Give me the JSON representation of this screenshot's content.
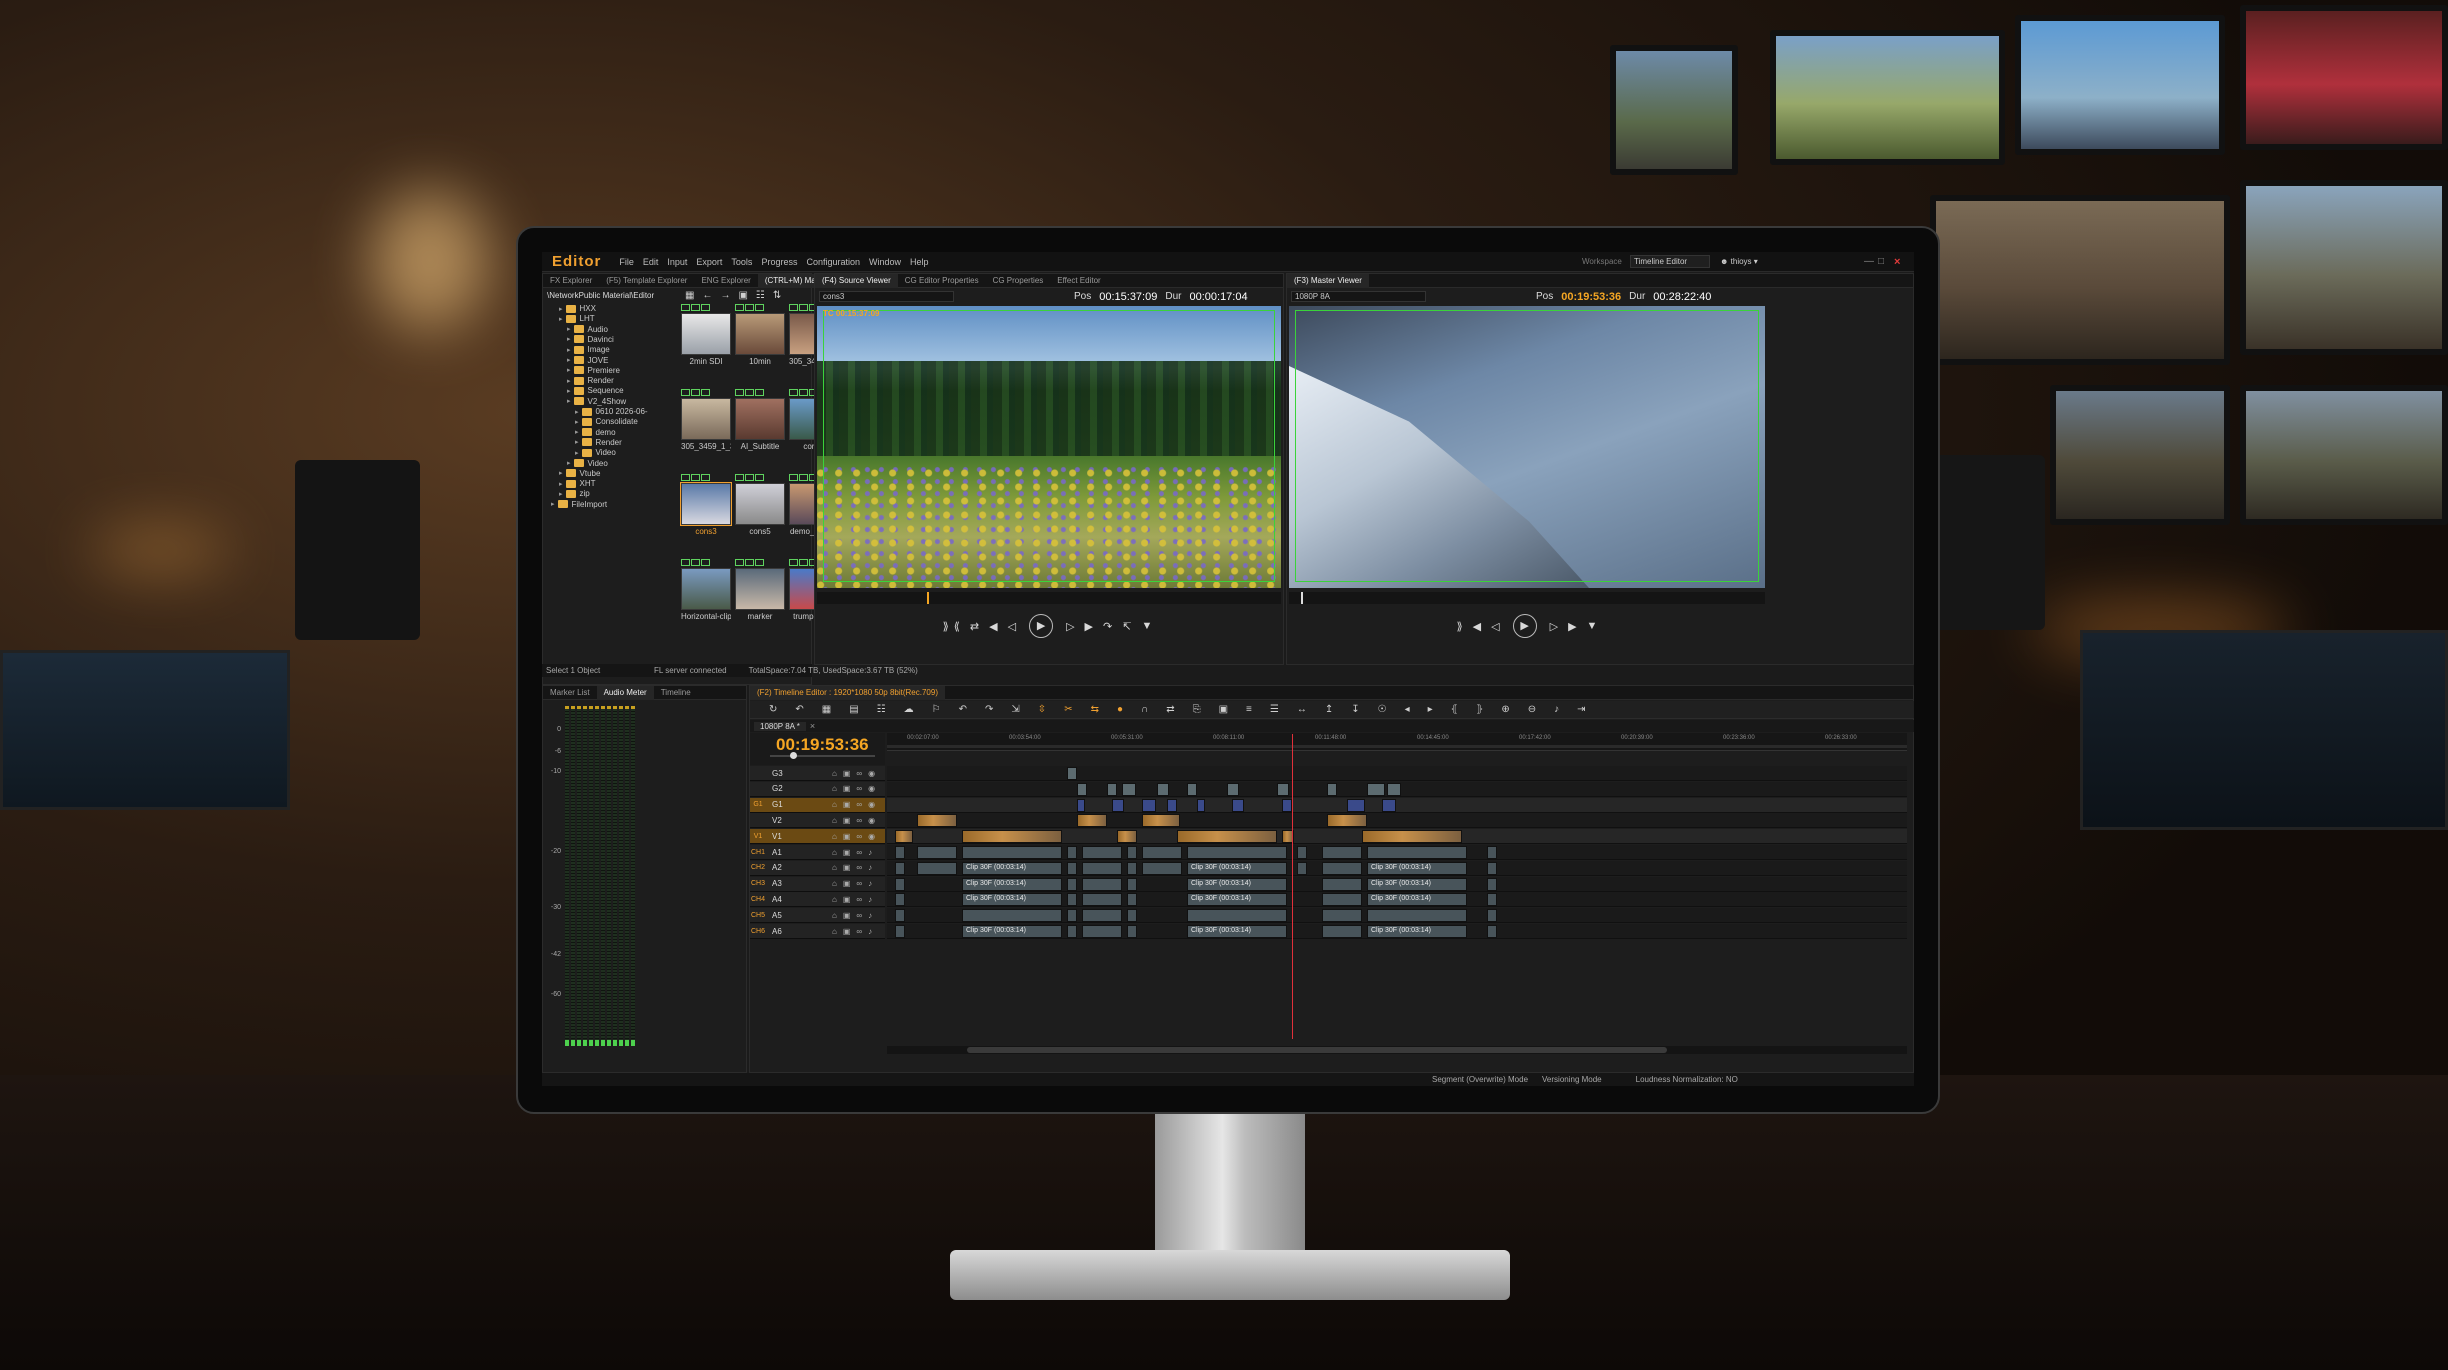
{
  "app": {
    "logo": "Editor"
  },
  "menu": [
    "File",
    "Edit",
    "Input",
    "Export",
    "Tools",
    "Progress",
    "Configuration",
    "Window",
    "Help"
  ],
  "workspace": {
    "label": "Workspace",
    "value": "Timeline Editor",
    "user": "thioys"
  },
  "explorer": {
    "tabs": [
      "FX Explorer",
      "(F5) Template Explorer",
      "ENG Explorer",
      "(CTRL+M) Material List"
    ],
    "path": "\\NetworkPublic Material\\Editor",
    "tree": [
      "HXX",
      "LHT",
      "Audio",
      "Davinci",
      "Image",
      "JOVE",
      "Premiere",
      "Render",
      "Sequence",
      "V2_4Show",
      "0610 2026-06-",
      "Consolidate",
      "demo",
      "Render",
      "Video",
      "Video",
      "Vtube",
      "XHT",
      "zip",
      "FileImport"
    ],
    "clips": [
      "2min SDI",
      "10min",
      "305_3455_1_43...",
      "305_3459_1_32...",
      "AI_Subtitle",
      "cons2",
      "cons3",
      "cons5",
      "demo_video1",
      "Horizontal-clip_c...",
      "marker",
      "trump video"
    ],
    "status_left": "Select 1 Object",
    "status_mid": "FL server connected",
    "status_right": "TotalSpace:7.04 TB, UsedSpace:3.67 TB (52%)"
  },
  "source_viewer": {
    "tabs": [
      "(F4) Source Viewer",
      "CG Editor Properties",
      "CG Properties",
      "Effect Editor"
    ],
    "clip": "cons3",
    "pos_label": "Pos",
    "pos": "00:15:37:09",
    "dur_label": "Dur",
    "dur": "00:00:17:04",
    "overlay_tc": "TC 00:15:37:09"
  },
  "master_viewer": {
    "tabs": [
      "(F3) Master Viewer"
    ],
    "format": "1080P 8A",
    "pos_label": "Pos",
    "pos": "00:19:53:36",
    "dur_label": "Dur",
    "dur": "00:28:22:40"
  },
  "bottom_left": {
    "tabs": [
      "Marker List",
      "Audio Meter",
      "Timeline"
    ],
    "scale": [
      "0",
      "-6",
      "-10",
      "-20",
      "-30",
      "-42",
      "-60"
    ]
  },
  "timeline": {
    "tab": "(F2) Timeline Editor : 1920*1080 50p 8bit(Rec.709)",
    "sequence": "1080P 8A *",
    "timecode": "00:19:53:36",
    "ruler": [
      "00:02:07:00",
      "00:03:54:00",
      "00:05:31:00",
      "00:08:11:00",
      "00:11:48:00",
      "00:14:45:00",
      "00:17:42:00",
      "00:20:39:00",
      "00:23:36:00",
      "00:26:33:00"
    ],
    "tracks": [
      {
        "name": "G3",
        "tag": ""
      },
      {
        "name": "G2",
        "tag": ""
      },
      {
        "name": "G1",
        "tag": "G1"
      },
      {
        "name": "V2",
        "tag": ""
      },
      {
        "name": "V1",
        "tag": "V1"
      },
      {
        "name": "A1",
        "tag": "CH1"
      },
      {
        "name": "A2",
        "tag": "CH2"
      },
      {
        "name": "A3",
        "tag": "CH3"
      },
      {
        "name": "A4",
        "tag": "CH4"
      },
      {
        "name": "A5",
        "tag": "CH5"
      },
      {
        "name": "A6",
        "tag": "CH6"
      }
    ],
    "audio_clip_label": "Clip 30F (00:03:14)"
  },
  "status": {
    "mode": "Segment (Overwrite) Mode",
    "versioning": "Versioning Mode",
    "loudness": "Loudness Normalization: NO"
  }
}
